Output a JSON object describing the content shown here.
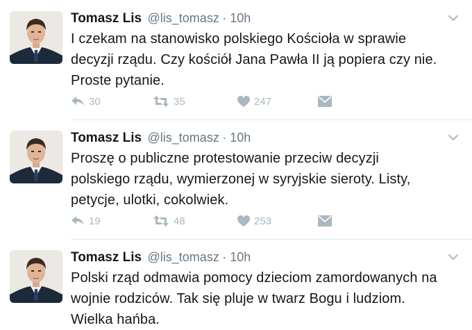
{
  "tweets": [
    {
      "name": "Tomasz Lis",
      "handle": "@lis_tomasz",
      "time": "· 10h",
      "lines": [
        "I czekam na stanowisko polskiego Kościoła w sprawie",
        "decyzji rządu. Czy kościół Jana Pawła II ją popiera czy nie.",
        "Proste pytanie."
      ],
      "replies": "30",
      "retweets": "35",
      "likes": "247"
    },
    {
      "name": "Tomasz Lis",
      "handle": "@lis_tomasz",
      "time": "· 10h",
      "lines": [
        "Proszę o publiczne protestowanie przeciw decyzji",
        "polskiego rządu, wymierzonej w syryjskie sieroty. Listy,",
        "petycje, ulotki, cokolwiek."
      ],
      "replies": "19",
      "retweets": "48",
      "likes": "253"
    },
    {
      "name": "Tomasz Lis",
      "handle": "@lis_tomasz",
      "time": "· 10h",
      "lines": [
        "Polski rząd odmawia pomocy dzieciom zamordowanych na",
        "wojnie rodziców. Tak się pluje w twarz Bogu i ludziom.",
        "Wielka hańba."
      ]
    }
  ],
  "colors": {
    "text": "#14171a",
    "secondary": "#657786",
    "icon": "#aab8c2",
    "divider": "#e1e8ed"
  },
  "icons": [
    "reply-icon",
    "retweet-icon",
    "like-icon",
    "message-icon",
    "chevron-down-icon",
    "avatar"
  ]
}
